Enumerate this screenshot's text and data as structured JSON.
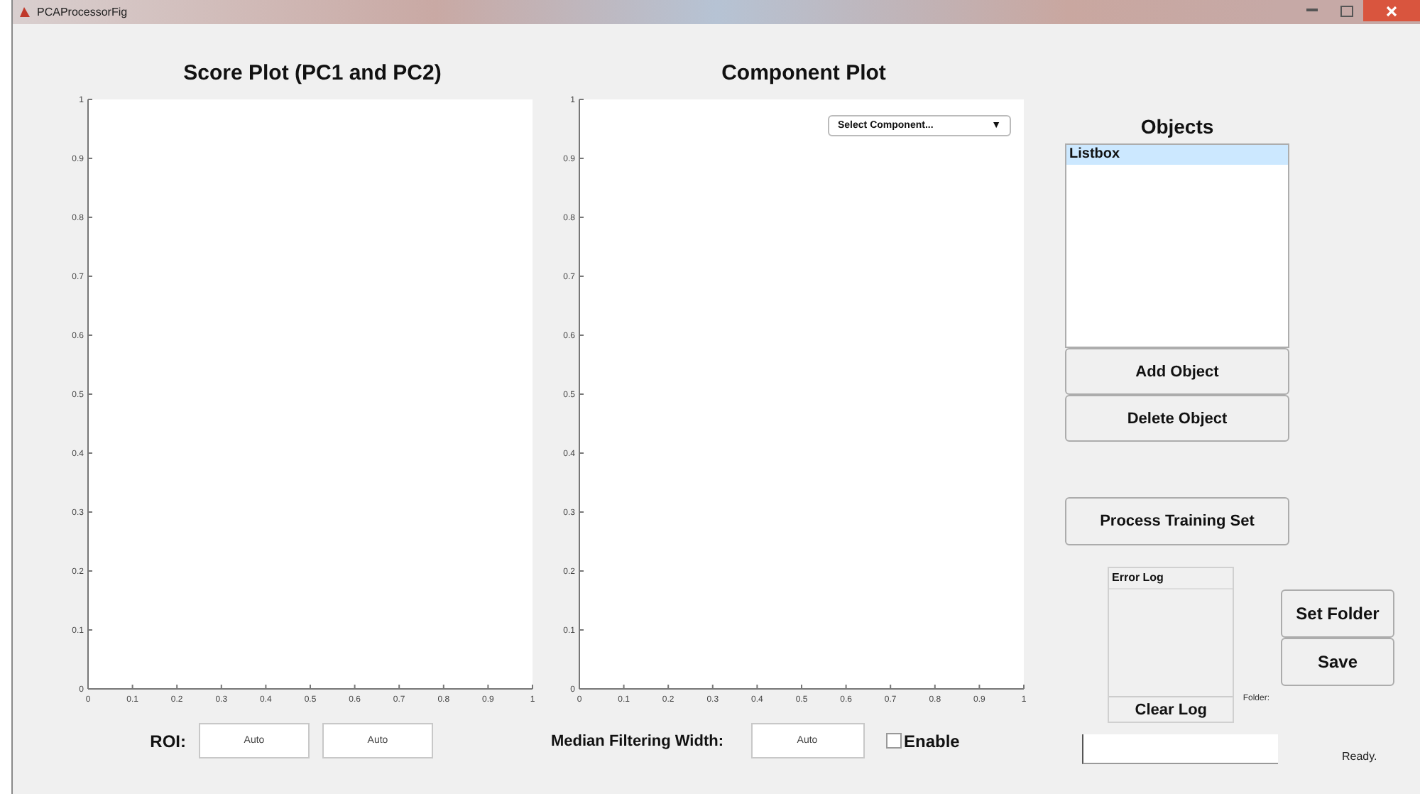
{
  "window": {
    "title": "PCAProcessorFig"
  },
  "score_plot": {
    "title": "Score Plot (PC1 and PC2)",
    "chart_data": {
      "type": "line",
      "xlim": [
        0,
        1
      ],
      "ylim": [
        0,
        1
      ],
      "xticks": [
        0,
        0.1,
        0.2,
        0.3,
        0.4,
        0.5,
        0.6,
        0.7,
        0.8,
        0.9,
        1
      ],
      "yticks": [
        0,
        0.1,
        0.2,
        0.3,
        0.4,
        0.5,
        0.6,
        0.7,
        0.8,
        0.9,
        1
      ]
    }
  },
  "roi": {
    "label": "ROI:",
    "fields": [
      {
        "value": "Auto"
      },
      {
        "value": "Auto"
      }
    ]
  },
  "component_plot": {
    "title": "Component Plot",
    "dropdown": {
      "value": "Select Component...",
      "arrow": "▼"
    },
    "chart_data": {
      "type": "line",
      "xlim": [
        0,
        1
      ],
      "ylim": [
        0,
        1
      ],
      "xticks": [
        0,
        0.1,
        0.2,
        0.3,
        0.4,
        0.5,
        0.6,
        0.7,
        0.8,
        0.9,
        1
      ],
      "yticks": [
        0,
        0.1,
        0.2,
        0.3,
        0.4,
        0.5,
        0.6,
        0.7,
        0.8,
        0.9,
        1
      ]
    }
  },
  "median_filter": {
    "label": "Median Filtering Width:",
    "field": {
      "value": "Auto"
    },
    "enable": {
      "label": "Enable",
      "checked": false
    }
  },
  "objects": {
    "title": "Objects",
    "items": [
      {
        "label": "Listbox",
        "selected": true
      }
    ],
    "buttons": [
      "Add Object",
      "Delete Object"
    ]
  },
  "process_button": "Process Training Set",
  "error_log": {
    "title": "Error Log",
    "button": "Clear Log"
  },
  "folder_label": "Folder:",
  "buttons": [
    "Set Folder",
    "Save"
  ],
  "status": "Ready."
}
